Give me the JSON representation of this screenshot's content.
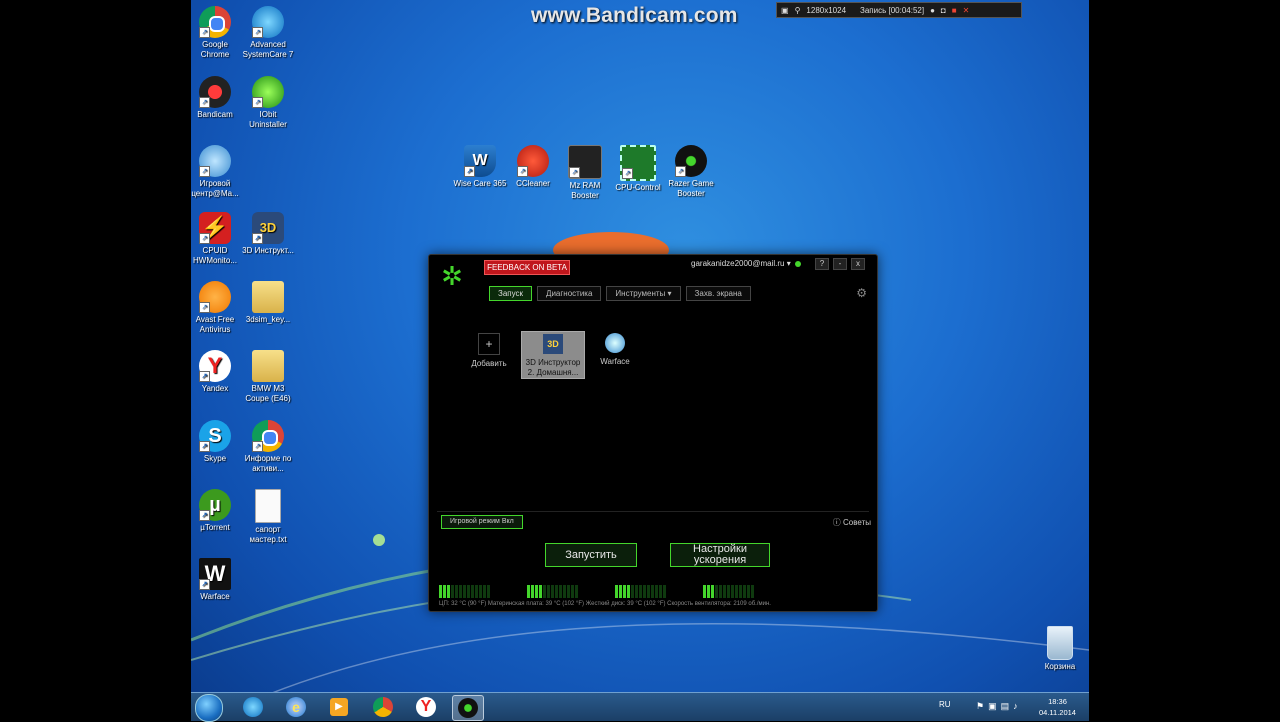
{
  "watermark": "www.Bandicam.com",
  "recorder": {
    "resolution": "1280x1024",
    "status": "Запись [00:04:52]"
  },
  "desktop_icons": [
    {
      "name": "chrome",
      "label": "Google Chrome",
      "icon": "chrome-icon"
    },
    {
      "name": "advanced-systemcare",
      "label": "Advanced SystemCare 7",
      "icon": "advanced-systemcare-icon"
    },
    {
      "name": "bandicam",
      "label": "Bandicam",
      "icon": "bandicam-icon"
    },
    {
      "name": "iobit-uninstaller",
      "label": "IObit Uninstaller",
      "icon": "iobit-icon"
    },
    {
      "name": "game-center",
      "label": "Игровой центр@Ma...",
      "icon": "game-center-icon"
    },
    {
      "name": "cpuid",
      "label": "CPUID HWMonito...",
      "icon": "cpuid-icon"
    },
    {
      "name": "3d-instruktor",
      "label": "3D Инструкт...",
      "icon": "3d-instructor-icon"
    },
    {
      "name": "avast",
      "label": "Avast Free Antivirus",
      "icon": "avast-icon"
    },
    {
      "name": "3dsim-folder",
      "label": "3dsim_key...",
      "icon": "folder-icon"
    },
    {
      "name": "yandex",
      "label": "Yandex",
      "icon": "yandex-icon"
    },
    {
      "name": "bmw-folder",
      "label": "BMW M3 Coupe (E46)",
      "icon": "folder-icon"
    },
    {
      "name": "skype",
      "label": "Skype",
      "icon": "skype-icon"
    },
    {
      "name": "chrome-info",
      "label": "Информе по активи...",
      "icon": "chrome-icon"
    },
    {
      "name": "utorrent",
      "label": "µTorrent",
      "icon": "utorrent-icon"
    },
    {
      "name": "text-file",
      "label": "сапорт мастер.txt",
      "icon": "text-file-icon"
    },
    {
      "name": "warface",
      "label": "Warface",
      "icon": "warface-icon"
    },
    {
      "name": "wise-care",
      "label": "Wise Care 365",
      "icon": "wise-care-icon"
    },
    {
      "name": "ccleaner",
      "label": "CCleaner",
      "icon": "ccleaner-icon"
    },
    {
      "name": "mz-ram",
      "label": "Mz RAM Booster",
      "icon": "ram-icon"
    },
    {
      "name": "cpu-control",
      "label": "CPU-Control",
      "icon": "cpu-icon"
    },
    {
      "name": "razer-booster",
      "label": "Razer Game Booster",
      "icon": "razer-icon"
    },
    {
      "name": "recycle-bin",
      "label": "Корзина",
      "icon": "recycle-bin-icon"
    }
  ],
  "razer": {
    "feedback": "FEEDBACK ON BETA",
    "user": "garakanidze2000@mail.ru ▾",
    "window_buttons": [
      "?",
      "-",
      "x"
    ],
    "tabs": [
      "Запуск",
      "Диагностика",
      "Инструменты ▾",
      "Захв. экрана"
    ],
    "games": [
      {
        "label": "Добавить",
        "icon": "add-icon"
      },
      {
        "label": "3D Инструктор 2. Домашня...",
        "icon": "3d-instructor-icon"
      },
      {
        "label": "Warface",
        "icon": "warface-icon"
      }
    ],
    "game_mode": "Игровой режим Вкл",
    "tips": "Советы",
    "launch": "Запустить",
    "boost_settings": "Настройки ускорения",
    "meters": [
      0.2,
      0.3,
      0.3,
      0.2
    ],
    "stats": "ЦП: 32 °C  (90 °F)          Материнская плата: 39 °C  (102 °F)    Жесткий диск: 39 °C  (102 °F)    Скорость вентилятора: 2109 об./мин."
  },
  "taskbar": {
    "lang": "RU",
    "time": "18:36",
    "date": "04.11.2014"
  },
  "colors": {
    "razer_green": "#44d62c",
    "feedback_red": "#c0161c"
  }
}
